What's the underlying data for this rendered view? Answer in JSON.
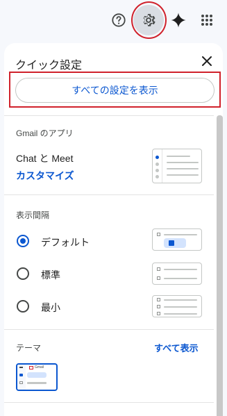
{
  "header": {
    "help_icon": "help-circle-icon",
    "settings_icon": "gear-icon",
    "gemini_icon": "gemini-sparkle-icon",
    "apps_icon": "apps-grid-icon"
  },
  "panel": {
    "title": "クイック設定",
    "close_icon": "close-icon",
    "all_settings_label": "すべての設定を表示"
  },
  "apps_section": {
    "label": "Gmail のアプリ",
    "item": "Chat と Meet",
    "customize_link": "カスタマイズ"
  },
  "density_section": {
    "label": "表示間隔",
    "options": [
      {
        "label": "デフォルト",
        "checked": true
      },
      {
        "label": "標準",
        "checked": false
      },
      {
        "label": "最小",
        "checked": false
      }
    ]
  },
  "theme_section": {
    "label": "テーマ",
    "view_all": "すべて表示",
    "preview_brand": "Gmail"
  },
  "colors": {
    "accent": "#0b57d0",
    "highlight": "#d0212b"
  }
}
